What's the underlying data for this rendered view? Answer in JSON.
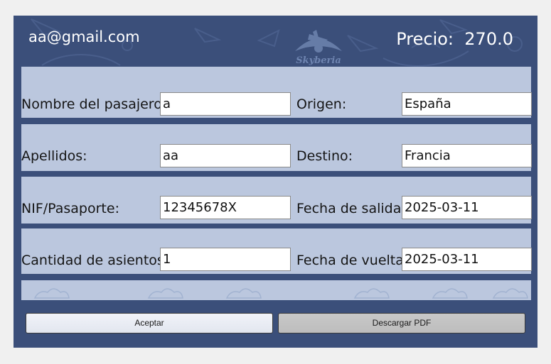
{
  "header": {
    "email": "aa@gmail.com",
    "price_label": "Precio:",
    "price_value": "270.0",
    "logo_text": "Skyberia"
  },
  "form": {
    "nombre": {
      "label": "Nombre del pasajero:",
      "value": "a"
    },
    "apellidos": {
      "label": "Apellidos:",
      "value": "aa"
    },
    "nif": {
      "label": "NIF/Pasaporte:",
      "value": "12345678X"
    },
    "asientos": {
      "label": "Cantidad de asientos:",
      "value": "1"
    },
    "origen": {
      "label": "Origen:",
      "value": "España"
    },
    "destino": {
      "label": "Destino:",
      "value": "Francia"
    },
    "salida": {
      "label": "Fecha de salida:",
      "value": "2025-03-11"
    },
    "vuelta": {
      "label": "Fecha de vuelta:",
      "value": "2025-03-11"
    }
  },
  "buttons": {
    "accept": "Aceptar",
    "pdf": "Descargar PDF"
  },
  "colors": {
    "window_bg": "#3b4f7a",
    "band_bg": "#cdd8ec"
  }
}
